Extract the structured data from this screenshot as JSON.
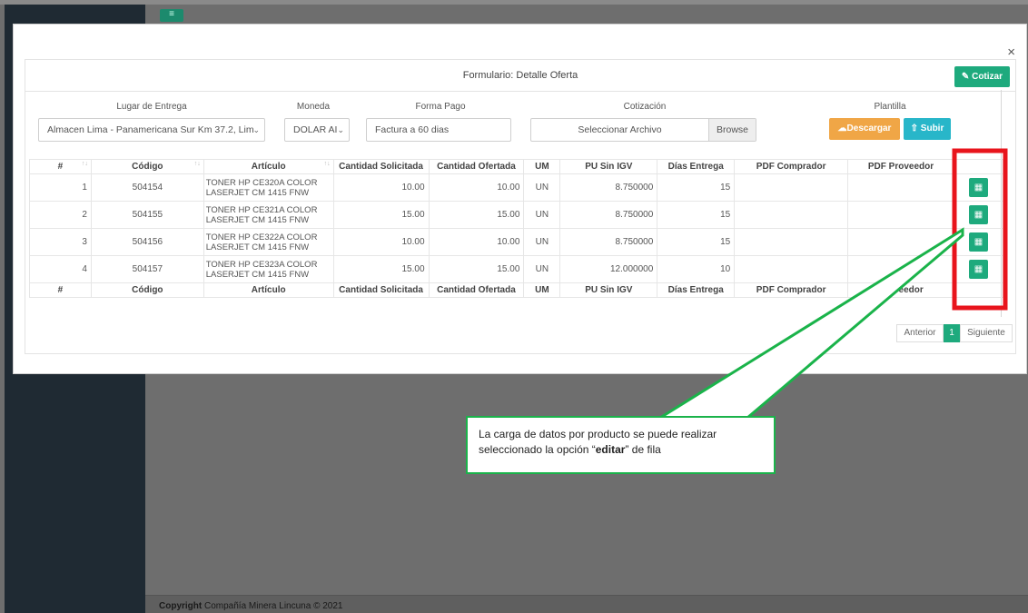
{
  "modal": {
    "close_icon": "×",
    "title": "Formulario: Detalle Oferta",
    "cotizar_label": "Cotizar",
    "cotizar_icon": "✎"
  },
  "form": {
    "lugar_label": "Lugar de Entrega",
    "lugar_value": "Almacen Lima - Panamericana Sur Km 37.2, Lim",
    "moneda_label": "Moneda",
    "moneda_value": "DOLAR AI",
    "forma_pago_label": "Forma Pago",
    "forma_pago_value": "Factura a  60 dias",
    "cotizacion_label": "Cotización",
    "cotizacion_placeholder": "Seleccionar Archivo",
    "browse_label": "Browse",
    "plantilla_label": "Plantilla",
    "descargar_label": "Descargar",
    "subir_label": "Subir"
  },
  "table": {
    "headers": [
      "#",
      "Código",
      "Artículo",
      "Cantidad Solicitada",
      "Cantidad Ofertada",
      "UM",
      "PU Sin IGV",
      "Días Entrega",
      "PDF Comprador",
      "PDF Proveedor",
      ""
    ],
    "footer_headers": [
      "#",
      "Código",
      "Artículo",
      "Cantidad Solicitada",
      "Cantidad Ofertada",
      "UM",
      "PU Sin IGV",
      "Días Entrega",
      "PDF Comprador",
      "Proveedor"
    ],
    "rows": [
      {
        "n": "1",
        "codigo": "504154",
        "articulo": "TONER HP CE320A COLOR LASERJET CM 1415 FNW",
        "solicitada": "10.00",
        "ofertada": "10.00",
        "um": "UN",
        "pu": "8.750000",
        "dias": "15"
      },
      {
        "n": "2",
        "codigo": "504155",
        "articulo": "TONER HP CE321A COLOR LASERJET CM 1415 FNW",
        "solicitada": "15.00",
        "ofertada": "15.00",
        "um": "UN",
        "pu": "8.750000",
        "dias": "15"
      },
      {
        "n": "3",
        "codigo": "504156",
        "articulo": "TONER HP CE322A COLOR LASERJET CM 1415 FNW",
        "solicitada": "10.00",
        "ofertada": "10.00",
        "um": "UN",
        "pu": "8.750000",
        "dias": "15"
      },
      {
        "n": "4",
        "codigo": "504157",
        "articulo": "TONER HP CE323A COLOR LASERJET CM 1415 FNW",
        "solicitada": "15.00",
        "ofertada": "15.00",
        "um": "UN",
        "pu": "12.000000",
        "dias": "10"
      }
    ]
  },
  "pager": {
    "prev_label": "Anterior",
    "page_label": "1",
    "next_label": "Siguiente"
  },
  "footer": {
    "copyright_label": "Copyright",
    "company": "Compañía Minera Lincuna © 2021"
  },
  "callout": {
    "line1": "La carga de datos por producto se puede realizar",
    "line2_pre": "seleccionado la opción “",
    "line2_bold": "editar",
    "line2_post": "” de fila"
  },
  "colors": {
    "accent_green": "#1eaa7d",
    "descargar_orange": "#f0a646",
    "subir_cyan": "#28b6c9",
    "highlight_red": "#e8141c",
    "callout_green": "#1ab34a"
  }
}
